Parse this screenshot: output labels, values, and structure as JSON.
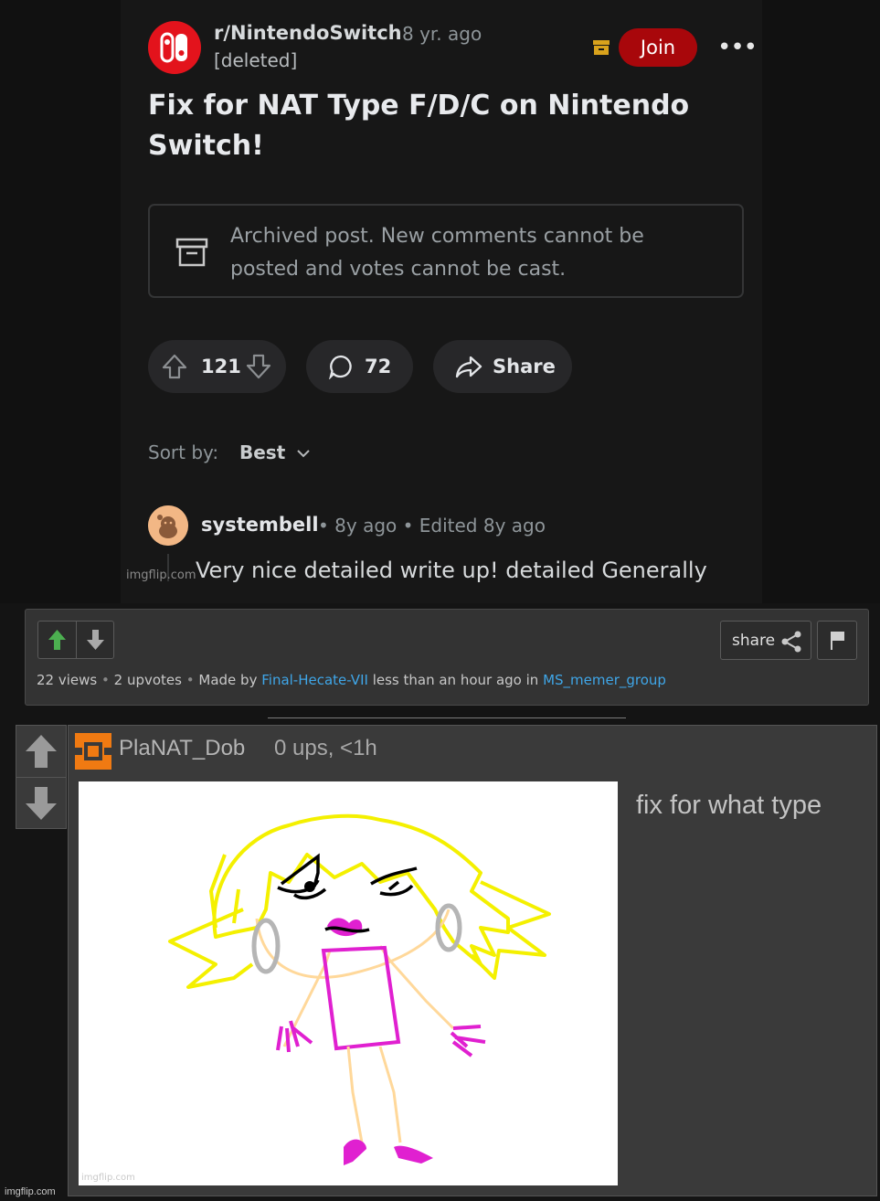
{
  "post": {
    "subreddit": "r/NintendoSwitch",
    "time": "8 yr. ago",
    "author": "[deleted]",
    "join_label": "Join",
    "more_label": "•••",
    "title": "Fix for NAT Type F/D/C on Nintendo Switch!",
    "archived_notice": "Archived post. New comments cannot be posted and votes cannot be cast.",
    "score": "121",
    "comments": "72",
    "share_label": "Share",
    "sort_label": "Sort by:",
    "sort_value": "Best"
  },
  "comment": {
    "author": "systembell",
    "meta": "• 8y ago • Edited 8y ago",
    "watermark": "imgflip.com",
    "body": "Very nice detailed write up! detailed Generally"
  },
  "imgflip_bar": {
    "share_label": "share",
    "views": "22 views",
    "upvotes": "2 upvotes",
    "made_by": "Made by",
    "author": "Final-Hecate-VII",
    "time": "less than an hour ago in",
    "stream": "MS_memer_group",
    "separator": "•"
  },
  "imgflip_comment": {
    "username": "PlaNAT_Dob",
    "meta": "0 ups, <1h",
    "text": "fix for what type",
    "image_watermark": "imgflip.com"
  },
  "footer_watermark": "imgflip.com",
  "colors": {
    "reddit_bg": "#171717",
    "join": "#a8070b",
    "nintendo_red": "#e3131c",
    "link": "#3fa6e8",
    "upvote_green": "#4caf50"
  },
  "icons": [
    "nintendo-switch-icon",
    "archive-icon",
    "more-icon",
    "upvote-icon",
    "downvote-icon",
    "comment-icon",
    "share-icon",
    "chevron-down-icon",
    "snoo-avatar-icon",
    "flag-icon",
    "imgflip-logo-icon"
  ]
}
